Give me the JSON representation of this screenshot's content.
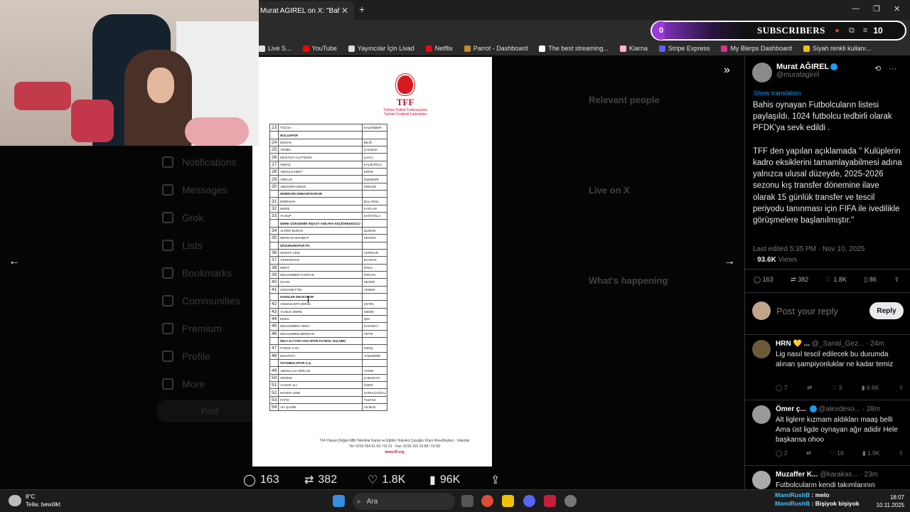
{
  "browser": {
    "tab_title": "Murat AĞIREL on X: \"Bahis oyna",
    "tab_close": "✕",
    "new_tab": "+",
    "window_controls": [
      "—",
      "❐",
      "✕"
    ],
    "bookmarks": [
      {
        "label": "Live S...",
        "color": "#e0e0e0"
      },
      {
        "label": "YouTube",
        "color": "#ff0000"
      },
      {
        "label": "Yayıncılar İçin Livad",
        "color": "#dddddd"
      },
      {
        "label": "Netflix",
        "color": "#e50914"
      },
      {
        "label": "Parrot - Dashboard",
        "color": "#c58a2a"
      },
      {
        "label": "The best streaming...",
        "color": "#ffffff"
      },
      {
        "label": "Klarna",
        "color": "#ffb3c7"
      },
      {
        "label": "Stripe Express",
        "color": "#635bff"
      },
      {
        "label": "My Blerps Dashboard",
        "color": "#d63384"
      },
      {
        "label": "Siyah renkli kullanı...",
        "color": "#f2c200"
      }
    ]
  },
  "overlay": {
    "sub_count": "0",
    "label": "SUBSCRIBERS",
    "right_count": "10"
  },
  "background": {
    "nav": [
      "Notifications",
      "Messages",
      "Grok",
      "Lists",
      "Bookmarks",
      "Communities",
      "Premium",
      "Profile",
      "More"
    ],
    "post_button": "Post",
    "right_sections": [
      "Relevant people",
      "Live on X",
      "What's happening"
    ]
  },
  "document": {
    "logo_title": "TFF",
    "logo_sub1": "Türkiye Futbol Federasyonu",
    "logo_sub2": "Turkish Football Federation",
    "rows": [
      {
        "n": "23",
        "first": "TOLGA",
        "last": "KALENDER"
      },
      {
        "n": "",
        "first": "BOLUSPOR",
        "last": "",
        "club": true
      },
      {
        "n": "24",
        "first": "ENSAR",
        "last": "BİLİR"
      },
      {
        "n": "25",
        "first": "TEMEL",
        "last": "ÇAKMAK"
      },
      {
        "n": "26",
        "first": "MUSTAFA ALPTEKİN",
        "last": "ÇAYLI"
      },
      {
        "n": "27",
        "first": "İSMAİL",
        "last": "KALBURCU"
      },
      {
        "n": "28",
        "first": "ABDULSAMET",
        "last": "KIRIM"
      },
      {
        "n": "29",
        "first": "ORKUN",
        "last": "ÖZDEMİR"
      },
      {
        "n": "30",
        "first": "ABDURRAHMAN",
        "last": "ÜRESİN"
      },
      {
        "n": "",
        "first": "EMİNEVİM ÜMRANİYESPOR",
        "last": "",
        "club": true
      },
      {
        "n": "31",
        "first": "EMİRHAN",
        "last": "BALARISI"
      },
      {
        "n": "32",
        "first": "EMRE",
        "last": "KAPLAN"
      },
      {
        "n": "33",
        "first": "YUSUF",
        "last": "SAİTOĞLU"
      },
      {
        "n": "",
        "first": "EMRE GÖKDEMİR İNŞAAT ANKARA KEÇİÖRENGÜCÜ",
        "last": "",
        "club": true
      },
      {
        "n": "34",
        "first": "ALPER BURAK",
        "last": "DUMAN"
      },
      {
        "n": "35",
        "first": "BERKAN MAHMUT",
        "last": "KESKİN"
      },
      {
        "n": "",
        "first": "ERZURUMSPOR FK",
        "last": "",
        "club": true
      },
      {
        "n": "36",
        "first": "MURAT CEM",
        "last": "AKPINAR"
      },
      {
        "n": "37",
        "first": "CENGİZHAN",
        "last": "BAYRAK"
      },
      {
        "n": "38",
        "first": "MERT",
        "last": "ÖNAL"
      },
      {
        "n": "39",
        "first": "MUHAMMED FURKAN",
        "last": "ÖZHAN"
      },
      {
        "n": "40",
        "first": "İLKAN",
        "last": "SEVER"
      },
      {
        "n": "41",
        "first": "HÜSAMETTİN",
        "last": "YENER"
      },
      {
        "n": "",
        "first": "ESENLER EROKSPOR",
        "last": "",
        "club": true
      },
      {
        "n": "42",
        "first": "OSMAN ERTUĞRUL",
        "last": "ÇETİN"
      },
      {
        "n": "43",
        "first": "YUNUS EMRE",
        "last": "GEDİK"
      },
      {
        "n": "44",
        "first": "ENES",
        "last": "IŞIK"
      },
      {
        "n": "45",
        "first": "MUHAMMED ARDA",
        "last": "KAHVECİ"
      },
      {
        "n": "46",
        "first": "MUHAMMED BERKAN",
        "last": "TETİK"
      },
      {
        "n": "",
        "first": "İMAJ ALTYAPI VAN SPOR FUTBOL KULÜBÜ",
        "last": "",
        "club": true
      },
      {
        "n": "47",
        "first": "FARUK CAN",
        "last": "GENÇ"
      },
      {
        "n": "48",
        "first": "MUSTAFA",
        "last": "TAŞDEMİR"
      },
      {
        "n": "",
        "first": "İSTANBULSPOR A.Ş.",
        "last": "",
        "club": true
      },
      {
        "n": "49",
        "first": "ABDULLAH DEİLAN",
        "last": "AYDIN"
      },
      {
        "n": "50",
        "first": "KEREM",
        "last": "KABADAYI"
      },
      {
        "n": "51",
        "first": "YUSUF ALİ",
        "last": "ÖZER"
      },
      {
        "n": "52",
        "first": "ENVER AZMİ",
        "last": "SARIALİOĞLU"
      },
      {
        "n": "53",
        "first": "FATİH",
        "last": "TULTAK"
      },
      {
        "n": "54",
        "first": "ALİ ŞAHİN",
        "last": "YILMAZ"
      }
    ],
    "footer_line1": "TFF Hasan Doğan Milli Takımlar Kamp ve Eğitim Tesisleri Çayağzı Köyü Riva-Beykoz · İstanbul",
    "footer_line2": "Tel: 0216 554 51 00 / 51 01 - Fax: 0216 319 19 58 / 19 59",
    "footer_url": "www.tff.org"
  },
  "media_actions": {
    "replies": "163",
    "reposts": "382",
    "likes": "1.8K",
    "views": "96K"
  },
  "panel": {
    "author_name": "Murat AĞIREL",
    "author_handle": "@muratagirel",
    "show_translation": "Show translation",
    "tweet_text": "Bahis oynayan Futbolcuların listesi paylaşıldı. 1024 futbolcu tedbirli olarak PFDK'ya sevk edildi .\n\nTFF den yapılan açıklamada '' Kulüplerin kadro eksiklerini tamamlayabilmesi adına yalnızca ulusal düzeyde, 2025-2026 sezonu kış transfer dönemine ilave olarak 15 günlük transfer ve tescil periyodu tanınması için FIFA ile ivedilikle görüşmelere başlanılmıştır.''",
    "edited": "Last edited 5:35 PM · Nov 10, 2025",
    "views": "93.6K",
    "views_label": "Views",
    "stats": {
      "replies": "163",
      "reposts": "382",
      "likes": "1.8K",
      "bookmarks": "86"
    },
    "reply_placeholder": "Post your reply",
    "reply_button": "Reply",
    "replies": [
      {
        "name": "HRN 💛 ...",
        "handle": "@_Sanal_Gez...",
        "time": "· 24m",
        "text": "Lig nasıl tescil edilecek bu durumda alınan şampiyonluklar ne kadar temiz",
        "replies": "7",
        "reposts": "",
        "likes": "3",
        "views": "6.6K"
      },
      {
        "name": "Ömer ç...",
        "handle": "@alexdeso...",
        "time": "· 28m",
        "text": "Alt liglere kızmam aldıkları maaş belli Ama üst ligde oynayan ağır adidir Hele başkansa ohoo",
        "replies": "2",
        "reposts": "",
        "likes": "16",
        "views": "1.9K"
      },
      {
        "name": "Muzaffer K...",
        "handle": "@karakas...",
        "time": "· 23m",
        "text": "Futbolcuların kendi takımlarının",
        "replies": "",
        "reposts": "",
        "likes": "",
        "views": ""
      }
    ]
  },
  "taskbar": {
    "temp": "8°C",
    "weather": "Teilw. bewölkt",
    "search": "Ara",
    "time": "18:07",
    "date": "10.11.2025",
    "chat_user": "MamiRushB",
    "chat_1": ": melo",
    "chat_2": ": Bişiyok bişiyok"
  }
}
